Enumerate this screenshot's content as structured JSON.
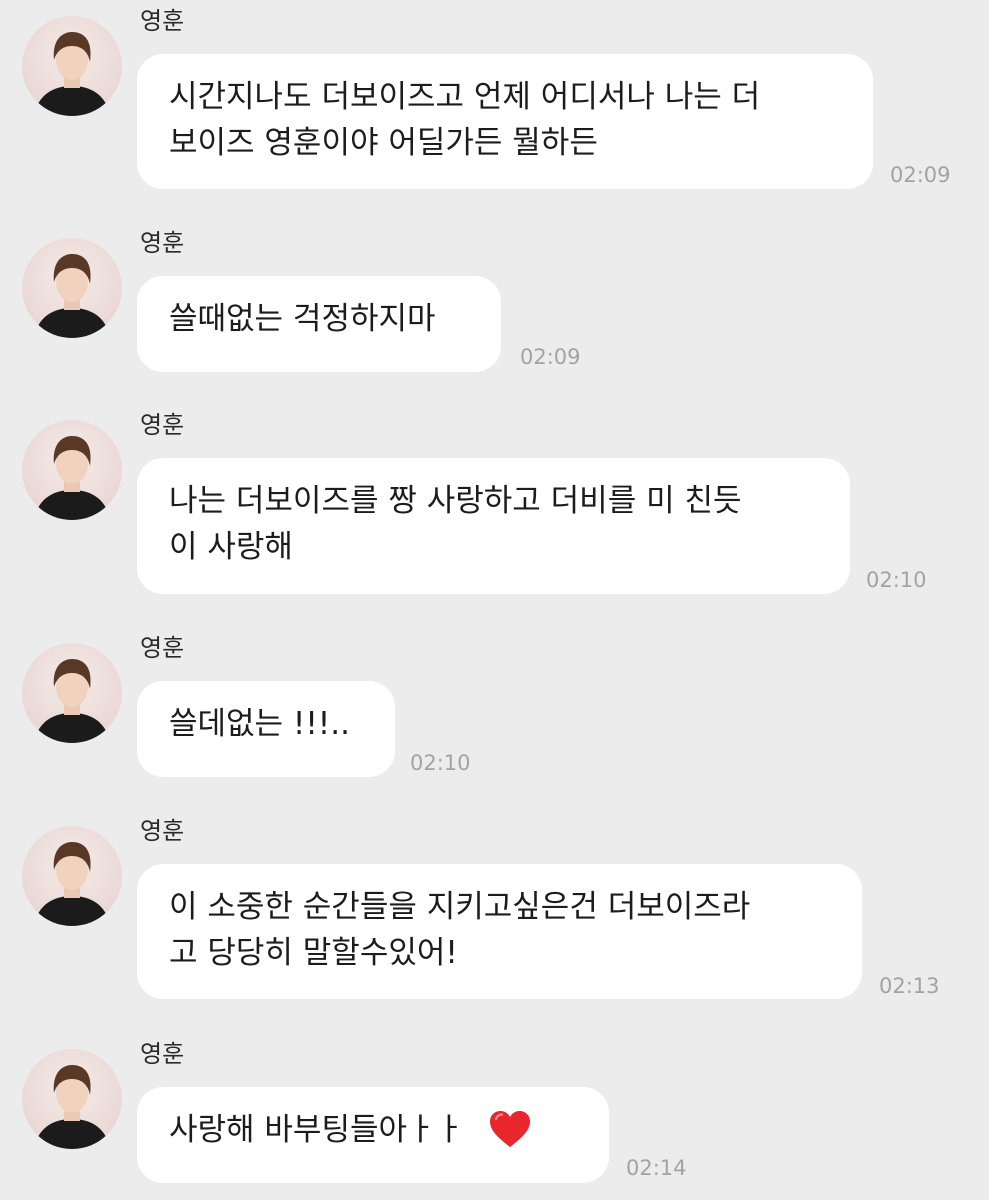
{
  "messages": [
    {
      "sender": "영훈",
      "text": "시간지나도 더보이즈고 언제 어디서나 나는 더\n보이즈 영훈이야 어딜가든 뭘하든",
      "time": "02:09"
    },
    {
      "sender": "영훈",
      "text": "쓸때없는 걱정하지마",
      "time": "02:09"
    },
    {
      "sender": "영훈",
      "text": "나는 더보이즈를 짱 사랑하고 더비를 미 친듯\n이 사랑해",
      "time": "02:10"
    },
    {
      "sender": "영훈",
      "text": "쓸데없는 !!!..",
      "time": "02:10"
    },
    {
      "sender": "영훈",
      "text": "이 소중한 순간들을 지키고싶은건 더보이즈라\n고 당당히 말할수있어!",
      "time": "02:13"
    },
    {
      "sender": "영훈",
      "text": "사랑해 바부팅들아ㅏㅏ ",
      "emoji": "heart-icon",
      "time": "02:14"
    }
  ],
  "colors": {
    "background": "#ececec",
    "bubble": "#ffffff",
    "text": "#1c1c1c",
    "time": "#a3a3a3",
    "heart": "#e8262c"
  }
}
